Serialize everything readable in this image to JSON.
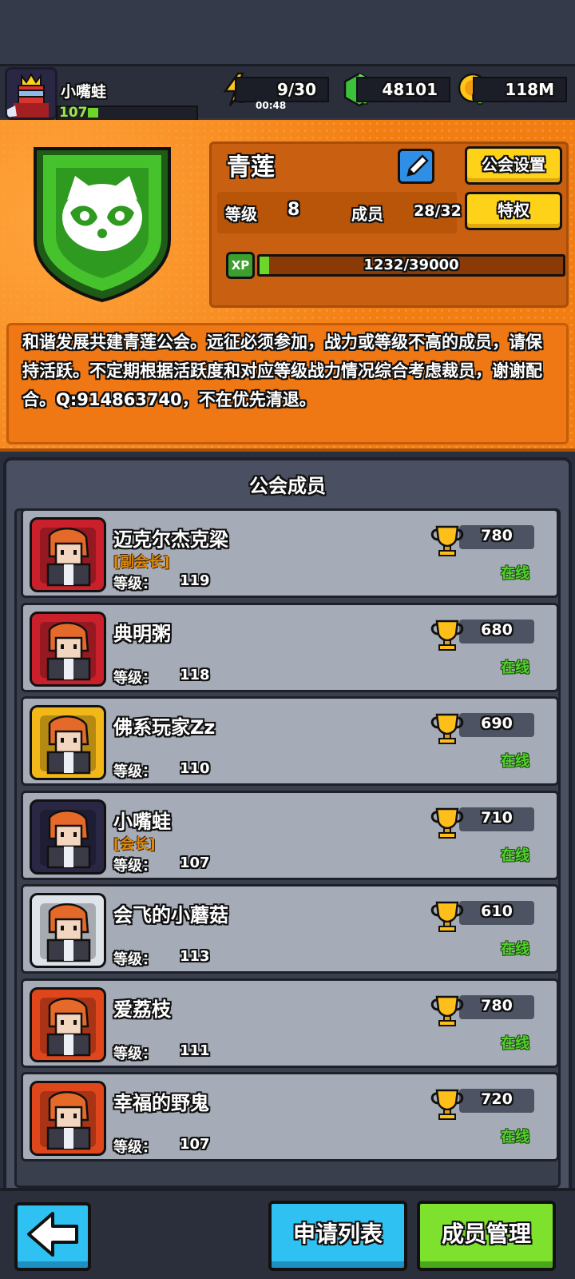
{
  "player": {
    "name": "小嘴蛙",
    "level": "107",
    "xp_fraction": 0.1
  },
  "resources": {
    "energy": "9/30",
    "energy_timer": "00:48",
    "gems": "48101",
    "coins": "118M"
  },
  "guild": {
    "name": "青莲",
    "settings_label": "公会设置",
    "privilege_label": "特权",
    "level_label": "等级",
    "level_value": "8",
    "member_label": "成员",
    "member_value": "28/32",
    "xp_badge": "XP",
    "xp_text": "1232/39000",
    "xp_fraction": 0.0316,
    "description": "和谐发展共建青莲公会。远征必须参加，战力或等级不高的成员，请保持活跃。不定期根据活跃度和对应等级战力情况综合考虑裁员，谢谢配合。Q:914863740，不在优先清退。"
  },
  "members_panel": {
    "title": "公会成员",
    "level_label": "等级：",
    "members": [
      {
        "name": "迈克尔杰克梁",
        "role": "[副会长]",
        "level": "119",
        "trophies": "780",
        "status": "在线",
        "avatar_color": "#c9202c"
      },
      {
        "name": "典明粥",
        "role": "",
        "level": "118",
        "trophies": "680",
        "status": "在线",
        "avatar_color": "#c9202c"
      },
      {
        "name": "佛系玩家Zz",
        "role": "",
        "level": "110",
        "trophies": "690",
        "status": "在线",
        "avatar_color": "#f2b718"
      },
      {
        "name": "小嘴蛙",
        "role": "[会长]",
        "level": "107",
        "trophies": "710",
        "status": "在线",
        "avatar_color": "#2a2744"
      },
      {
        "name": "会飞的小蘑菇",
        "role": "",
        "level": "113",
        "trophies": "610",
        "status": "在线",
        "avatar_color": "#dfe3ea"
      },
      {
        "name": "爱荔枝",
        "role": "",
        "level": "111",
        "trophies": "780",
        "status": "在线",
        "avatar_color": "#e0461c"
      },
      {
        "name": "幸福的野鬼",
        "role": "",
        "level": "107",
        "trophies": "720",
        "status": "在线",
        "avatar_color": "#e0461c"
      }
    ]
  },
  "bottom": {
    "apply_label": "申请列表",
    "manage_label": "成员管理"
  },
  "colors": {
    "accent_orange": "#f27d12",
    "button_blue": "#2fc1f2",
    "button_green": "#7ee12d",
    "online_green": "#52d32e"
  }
}
